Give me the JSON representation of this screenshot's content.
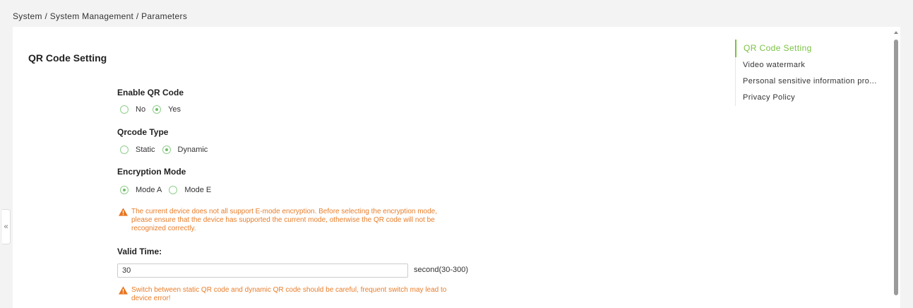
{
  "breadcrumb": "System / System Management / Parameters",
  "collapse_icon": "«",
  "section": {
    "title": "QR Code Setting"
  },
  "enable_qr": {
    "label": "Enable QR Code",
    "options": [
      {
        "label": "No",
        "checked": false
      },
      {
        "label": "Yes",
        "checked": true
      }
    ]
  },
  "qrcode_type": {
    "label": "Qrcode Type",
    "options": [
      {
        "label": "Static",
        "checked": false
      },
      {
        "label": "Dynamic",
        "checked": true
      }
    ]
  },
  "encryption_mode": {
    "label": "Encryption Mode",
    "options": [
      {
        "label": "Mode A",
        "checked": true
      },
      {
        "label": "Mode E",
        "checked": false
      }
    ],
    "warning": "The current device does not all support E-mode encryption. Before selecting the encryption mode, please ensure that the device has supported the current mode, otherwise the QR code will not be recognized correctly."
  },
  "valid_time": {
    "label": "Valid Time:",
    "value": "30",
    "suffix": "second(30-300)",
    "warning": "Switch between static QR code and dynamic QR code should be careful, frequent switch may lead to device error!"
  },
  "anchor_nav": {
    "items": [
      {
        "label": "QR Code Setting",
        "active": true
      },
      {
        "label": "Video watermark",
        "active": false
      },
      {
        "label": "Personal sensitive information pro...",
        "active": false
      },
      {
        "label": "Privacy Policy",
        "active": false
      }
    ]
  },
  "colors": {
    "accent": "#7ac143",
    "warning": "#e87d2a",
    "radio_border": "#8fce8b"
  }
}
